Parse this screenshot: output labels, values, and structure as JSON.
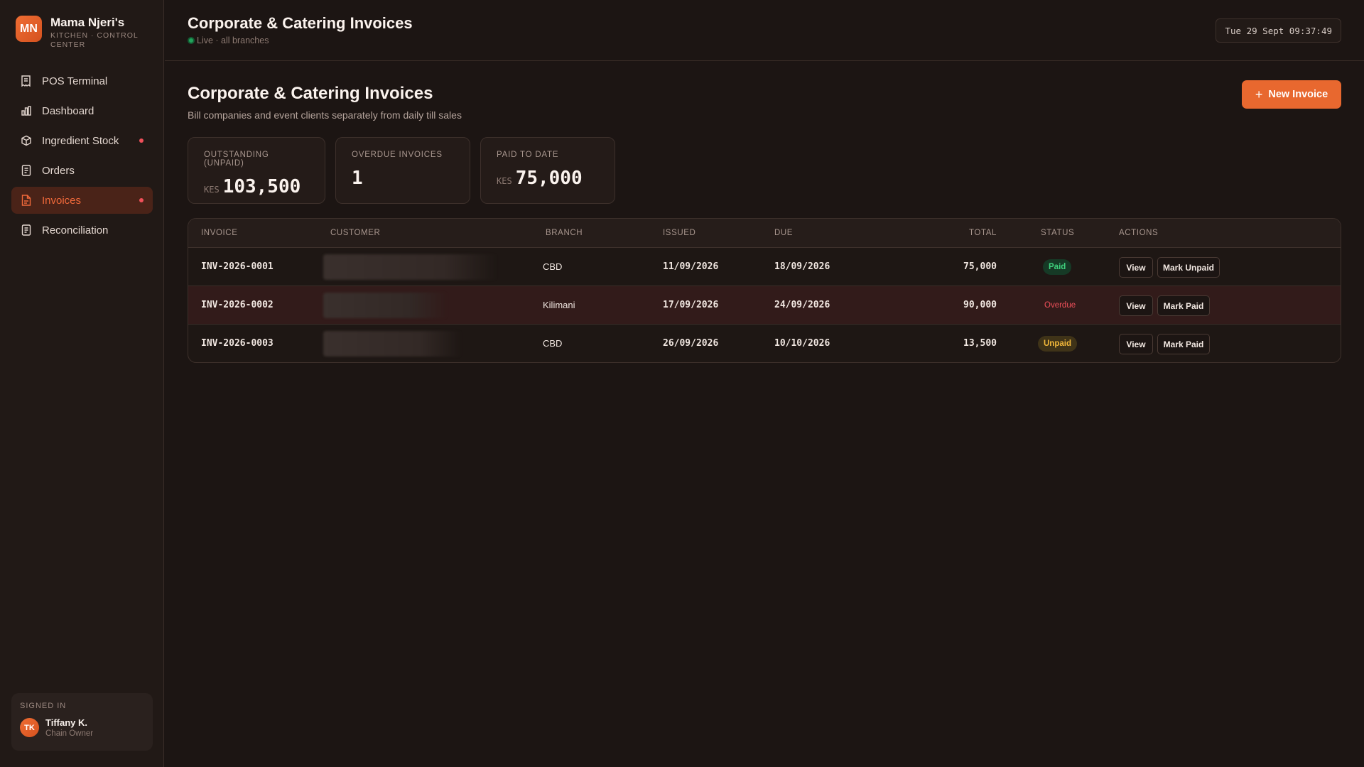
{
  "brand": {
    "initials": "MN",
    "name": "Mama Njeri's",
    "subtitle": "KITCHEN · CONTROL CENTER"
  },
  "sidebar": {
    "items": [
      {
        "label": "POS Terminal",
        "icon": "receipt-icon",
        "active": false,
        "alert": false
      },
      {
        "label": "Dashboard",
        "icon": "bar-chart-icon",
        "active": false,
        "alert": false
      },
      {
        "label": "Ingredient Stock",
        "icon": "box-icon",
        "active": false,
        "alert": true
      },
      {
        "label": "Orders",
        "icon": "document-icon",
        "active": false,
        "alert": false
      },
      {
        "label": "Invoices",
        "icon": "invoice-icon",
        "active": true,
        "alert": true
      },
      {
        "label": "Reconciliation",
        "icon": "document-icon",
        "active": false,
        "alert": false
      }
    ],
    "signed_in": {
      "label": "SIGNED IN",
      "initials": "TK",
      "name": "Tiffany K.",
      "role": "Chain Owner"
    }
  },
  "header": {
    "title": "Corporate & Catering Invoices",
    "status": "Live · all branches",
    "clock": "Tue 29 Sept 09:37:49"
  },
  "main": {
    "title": "Corporate & Catering Invoices",
    "subtitle": "Bill companies and event clients separately from daily till sales",
    "new_button": "New Invoice",
    "stats": [
      {
        "label": "OUTSTANDING (UNPAID)",
        "currency": "KES",
        "value": "103,500"
      },
      {
        "label": "OVERDUE INVOICES",
        "currency": "",
        "value": "1"
      },
      {
        "label": "PAID TO DATE",
        "currency": "KES",
        "value": "75,000"
      }
    ],
    "table": {
      "columns": [
        "INVOICE",
        "CUSTOMER",
        "BRANCH",
        "ISSUED",
        "DUE",
        "TOTAL",
        "STATUS",
        "ACTIONS"
      ],
      "rows": [
        {
          "invoice": "INV-2026-0001",
          "branch": "CBD",
          "issued": "11/09/2026",
          "due": "18/09/2026",
          "total": "75,000",
          "status": "Paid",
          "view": "View",
          "mark": "Mark Unpaid"
        },
        {
          "invoice": "INV-2026-0002",
          "branch": "Kilimani",
          "issued": "17/09/2026",
          "due": "24/09/2026",
          "total": "90,000",
          "status": "Overdue",
          "view": "View",
          "mark": "Mark Paid"
        },
        {
          "invoice": "INV-2026-0003",
          "branch": "CBD",
          "issued": "26/09/2026",
          "due": "10/10/2026",
          "total": "13,500",
          "status": "Unpaid",
          "view": "View",
          "mark": "Mark Paid"
        }
      ]
    }
  },
  "colors": {
    "accent": "#e8682f",
    "background": "#1c1513",
    "paid": "#3fd17d",
    "overdue": "#f0505a",
    "unpaid": "#f2b83a"
  }
}
